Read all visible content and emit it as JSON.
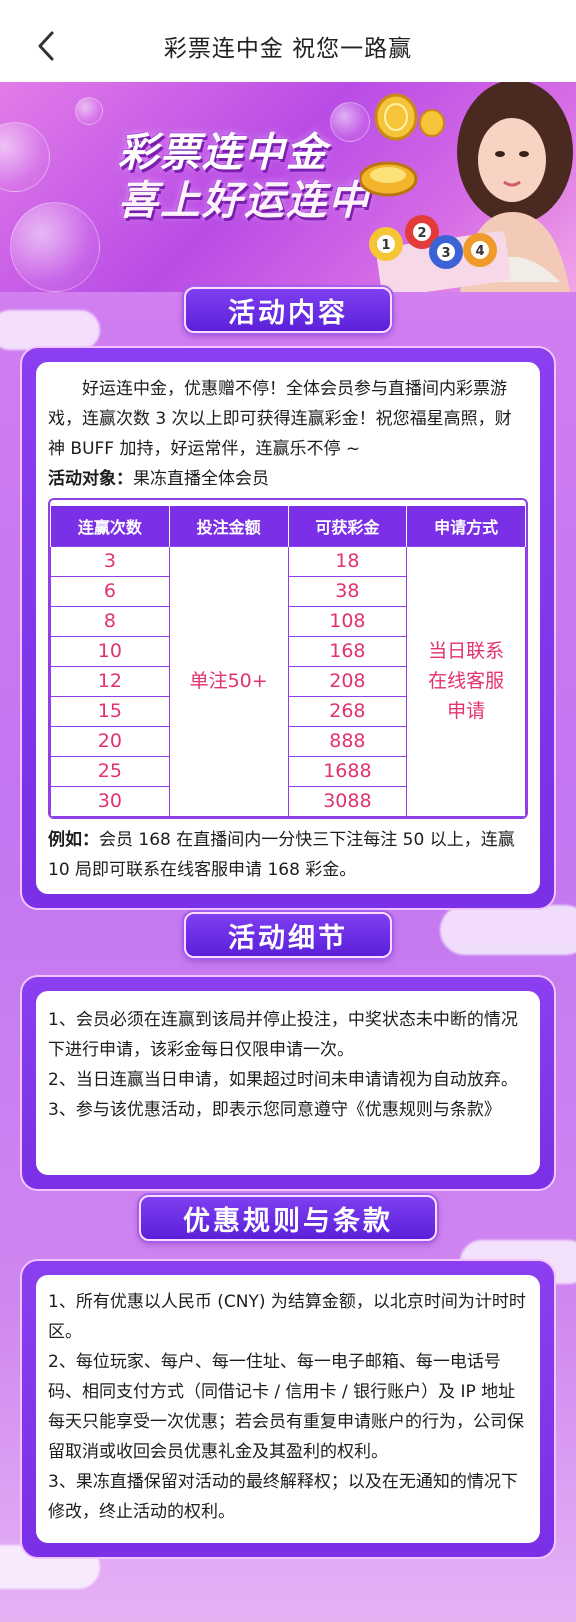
{
  "nav": {
    "title": "彩票连中金 祝您一路赢"
  },
  "banner": {
    "line1": "彩票连中金",
    "line2": "喜上好运连中",
    "balls": [
      "1",
      "2",
      "3",
      "4"
    ]
  },
  "section1": {
    "title": "活动内容",
    "intro": "好运连中金，优惠赠不停！全体会员参与直播间内彩票游戏，连赢次数 3 次以上即可获得连赢彩金！祝您福星高照，财神 BUFF 加持，好运常伴，连赢乐不停 ~",
    "target_label": "活动对象：",
    "target_value": "果冻直播全体会员",
    "table": {
      "headers": [
        "连赢次数",
        "投注金额",
        "可获彩金",
        "申请方式"
      ],
      "wins": [
        "3",
        "6",
        "8",
        "10",
        "12",
        "15",
        "20",
        "25",
        "30"
      ],
      "bet": "单注50+",
      "bonus": [
        "18",
        "38",
        "108",
        "168",
        "208",
        "268",
        "888",
        "1688",
        "3088"
      ],
      "apply": [
        "当日联系",
        "在线客服",
        "申请"
      ]
    },
    "example_label": "例如：",
    "example_text": "会员 168 在直播间内一分快三下注每注 50 以上，连赢 10 局即可联系在线客服申请 168 彩金。"
  },
  "section2": {
    "title": "活动细节",
    "items": [
      "1、会员必须在连赢到该局并停止投注，中奖状态未中断的情况下进行申请，该彩金每日仅限申请一次。",
      "2、当日连赢当日申请，如果超过时间未申请请视为自动放弃。",
      "3、参与该优惠活动，即表示您同意遵守《优惠规则与条款》"
    ]
  },
  "section3": {
    "title": "优惠规则与条款",
    "items": [
      "1、所有优惠以人民币 (CNY) 为结算金额，以北京时间为计时时区。",
      "2、每位玩家、每户、每一住址、每一电子邮箱、每一电话号码、相同支付方式（同借记卡 / 信用卡 / 银行账户）及 IP 地址每天只能享受一次优惠；若会员有重复申请账户的行为，公司保留取消或收回会员优惠礼金及其盈利的权利。",
      "3、果冻直播保留对活动的最终解释权；以及在无通知的情况下修改，终止活动的权利。"
    ]
  },
  "colors": {
    "accent_purple": "#7b2fe6",
    "value_pink": "#e2336e"
  }
}
